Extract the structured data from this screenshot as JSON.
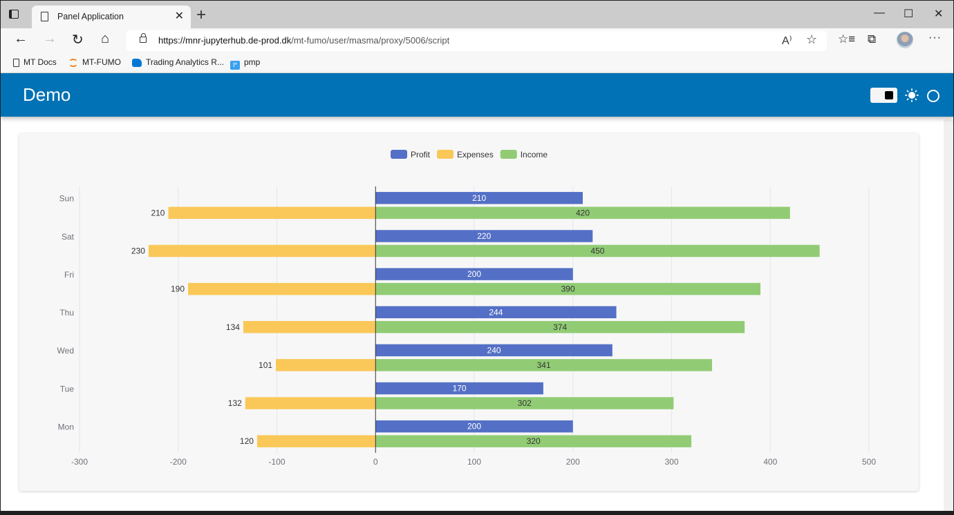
{
  "browser": {
    "tab_title": "Panel Application",
    "url_host": "https://mnr-jupyterhub.de-prod.dk",
    "url_path": "/mt-fumo/user/masma/proxy/5006/script",
    "bookmarks": [
      {
        "label": "MT Docs",
        "icon": "page-icon"
      },
      {
        "label": "MT-FUMO",
        "icon": "arc-icon"
      },
      {
        "label": "Trading Analytics R...",
        "icon": "azure-devops-icon"
      },
      {
        "label": "pmp",
        "icon": "pmp-icon"
      }
    ],
    "icons": {
      "back": "←",
      "forward": "→",
      "reload": "↻",
      "home": "⌂",
      "read_aloud": "A⁾",
      "add_favorite": "☆",
      "favorites": "☆≡",
      "collections": "⧉",
      "more": "···",
      "minimize": "—",
      "maximize": "☐",
      "close": "✕",
      "tab_close": "✕",
      "new_tab": "+"
    }
  },
  "app": {
    "title": "Demo",
    "header_color": "#0072b5"
  },
  "chart_data": {
    "type": "bar",
    "orientation": "horizontal",
    "categories": [
      "Mon",
      "Tue",
      "Wed",
      "Thu",
      "Fri",
      "Sat",
      "Sun"
    ],
    "series": [
      {
        "name": "Profit",
        "color": "#5470c6",
        "values": [
          200,
          170,
          240,
          244,
          200,
          220,
          210
        ],
        "label_position": "inside"
      },
      {
        "name": "Expenses",
        "color": "#fac858",
        "values": [
          -120,
          -132,
          -101,
          -134,
          -190,
          -230,
          -210
        ],
        "label_position": "left",
        "stack": "total"
      },
      {
        "name": "Income",
        "color": "#91cc75",
        "values": [
          320,
          302,
          341,
          374,
          390,
          450,
          420
        ],
        "label_position": "inside",
        "stack": "total"
      }
    ],
    "xlim": [
      -300,
      500
    ],
    "xticks": [
      -300,
      -200,
      -100,
      0,
      100,
      200,
      300,
      400,
      500
    ],
    "grid": true,
    "legend": "top-center",
    "title": "",
    "xlabel": "",
    "ylabel": ""
  }
}
